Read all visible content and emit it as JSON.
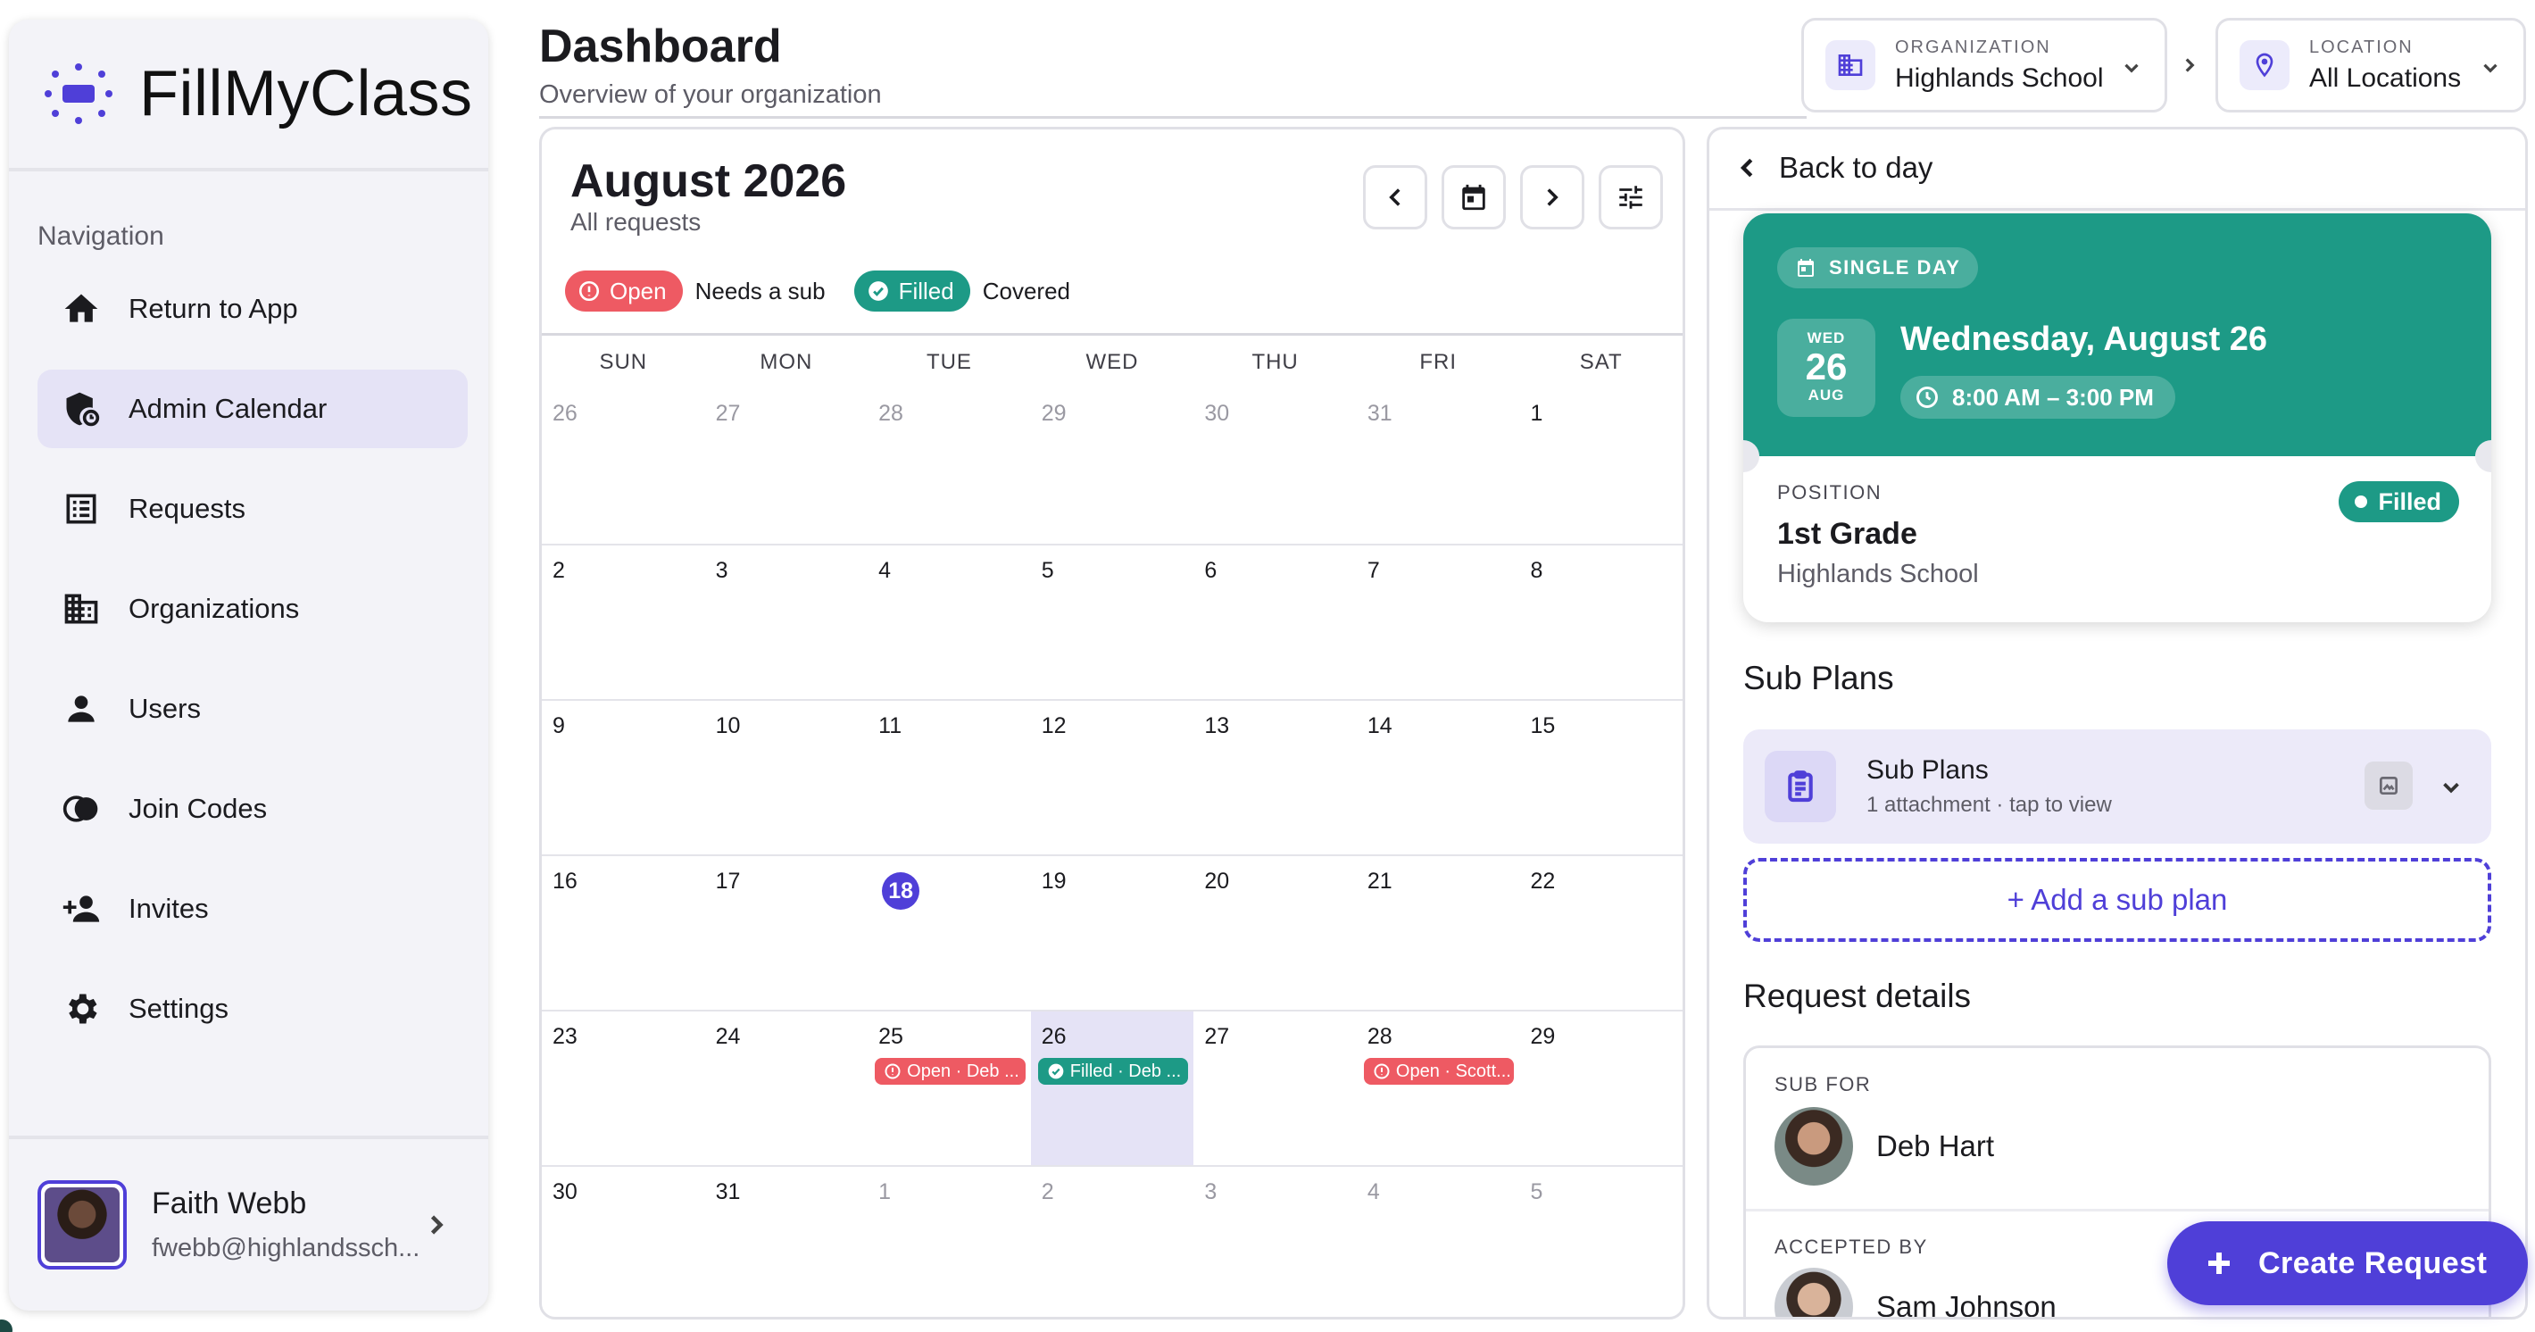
{
  "app": {
    "name": "FillMyClass"
  },
  "colors": {
    "accent": "#4f3fd8",
    "open": "#ee5a63",
    "filled": "#1d9a86",
    "selected_day": "#e5e3f6"
  },
  "sidebar": {
    "heading": "Navigation",
    "items": [
      {
        "label": "Return to App",
        "icon": "home-icon"
      },
      {
        "label": "Admin Calendar",
        "icon": "calendar-shield-icon",
        "active": true
      },
      {
        "label": "Requests",
        "icon": "list-icon"
      },
      {
        "label": "Organizations",
        "icon": "building-icon"
      },
      {
        "label": "Users",
        "icon": "person-icon"
      },
      {
        "label": "Join Codes",
        "icon": "toggle-icon"
      },
      {
        "label": "Invites",
        "icon": "person-add-icon"
      },
      {
        "label": "Settings",
        "icon": "gear-icon"
      }
    ],
    "user": {
      "name": "Faith Webb",
      "email": "fwebb@highlandssch..."
    }
  },
  "header": {
    "title": "Dashboard",
    "subtitle": "Overview of your organization",
    "organization": {
      "caption": "ORGANIZATION",
      "value": "Highlands School"
    },
    "location": {
      "caption": "LOCATION",
      "value": "All Locations"
    }
  },
  "calendar": {
    "month": "August 2026",
    "subtitle": "All requests",
    "legend": [
      {
        "pill": "Open",
        "text": "Needs a sub"
      },
      {
        "pill": "Filled",
        "text": "Covered"
      }
    ],
    "weekdays": [
      "SUN",
      "MON",
      "TUE",
      "WED",
      "THU",
      "FRI",
      "SAT"
    ],
    "weeks": [
      [
        {
          "d": "26",
          "m": true
        },
        {
          "d": "27",
          "m": true
        },
        {
          "d": "28",
          "m": true
        },
        {
          "d": "29",
          "m": true
        },
        {
          "d": "30",
          "m": true
        },
        {
          "d": "31",
          "m": true
        },
        {
          "d": "1"
        }
      ],
      [
        {
          "d": "2"
        },
        {
          "d": "3"
        },
        {
          "d": "4"
        },
        {
          "d": "5"
        },
        {
          "d": "6"
        },
        {
          "d": "7"
        },
        {
          "d": "8"
        }
      ],
      [
        {
          "d": "9"
        },
        {
          "d": "10"
        },
        {
          "d": "11"
        },
        {
          "d": "12"
        },
        {
          "d": "13"
        },
        {
          "d": "14"
        },
        {
          "d": "15"
        }
      ],
      [
        {
          "d": "16"
        },
        {
          "d": "17"
        },
        {
          "d": "18",
          "today": true
        },
        {
          "d": "19"
        },
        {
          "d": "20"
        },
        {
          "d": "21"
        },
        {
          "d": "22"
        }
      ],
      [
        {
          "d": "23"
        },
        {
          "d": "24"
        },
        {
          "d": "25",
          "event": {
            "type": "open",
            "label": "Open · Deb ..."
          }
        },
        {
          "d": "26",
          "selected": true,
          "event": {
            "type": "filled",
            "label": "Filled · Deb ..."
          }
        },
        {
          "d": "27"
        },
        {
          "d": "28",
          "event": {
            "type": "open",
            "label": "Open · Scott..."
          }
        },
        {
          "d": "29"
        }
      ],
      [
        {
          "d": "30"
        },
        {
          "d": "31"
        },
        {
          "d": "1",
          "m": true
        },
        {
          "d": "2",
          "m": true
        },
        {
          "d": "3",
          "m": true
        },
        {
          "d": "4",
          "m": true
        },
        {
          "d": "5",
          "m": true
        }
      ]
    ]
  },
  "detail": {
    "back_label": "Back to day",
    "type_chip": "SINGLE DAY",
    "badge": {
      "weekday": "WED",
      "day": "26",
      "month": "AUG"
    },
    "date": "Wednesday, August 26",
    "time": "8:00 AM – 3:00 PM",
    "position_caption": "POSITION",
    "position": "1st Grade",
    "organization": "Highlands School",
    "status": "Filled",
    "sub_plans_heading": "Sub Plans",
    "sub_plans": {
      "title": "Sub Plans",
      "meta": "1 attachment · tap to view"
    },
    "add_sub_plan": "+ Add a sub plan",
    "request_details_heading": "Request details",
    "sub_for_caption": "SUB FOR",
    "sub_for_name": "Deb Hart",
    "accepted_by_caption": "ACCEPTED BY",
    "accepted_by_name": "Sam Johnson"
  },
  "fab": {
    "label": "Create Request"
  }
}
